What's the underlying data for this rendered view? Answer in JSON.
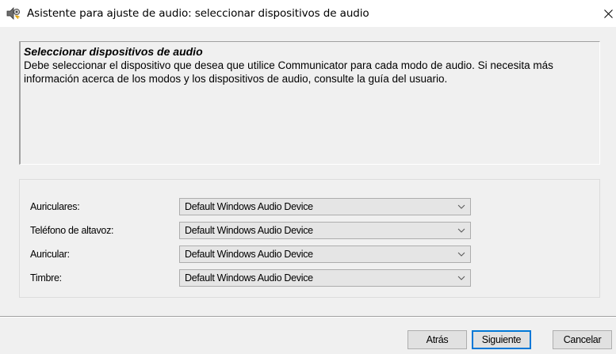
{
  "window": {
    "title": "Asistente para ajuste de audio: seleccionar dispositivos de audio",
    "icon": "audio-wizard-icon",
    "close_icon": "close-icon"
  },
  "header": {
    "heading": "Seleccionar dispositivos de audio",
    "description": "Debe seleccionar el dispositivo que desea que utilice Communicator para cada modo de audio. Si necesita más información acerca de los modos y los dispositivos de audio, consulte la guía del usuario."
  },
  "devices": [
    {
      "label": "Auriculares:",
      "value": "Default Windows Audio Device"
    },
    {
      "label": "Teléfono de altavoz:",
      "value": "Default Windows Audio Device"
    },
    {
      "label": "Auricular:",
      "value": "Default Windows Audio Device"
    },
    {
      "label": "Timbre:",
      "value": "Default Windows Audio Device"
    }
  ],
  "buttons": {
    "back": "Atrás",
    "next": "Siguiente",
    "cancel": "Cancelar"
  },
  "colors": {
    "default_button_border": "#0078d7",
    "window_background": "#f0f0f0"
  }
}
